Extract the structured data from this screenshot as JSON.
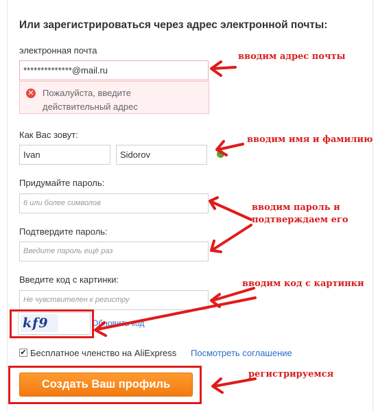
{
  "form": {
    "heading": "Или зарегистрироваться через адрес электронной почты:",
    "email": {
      "label": "электронная почта",
      "value": "**************@mail.ru",
      "error": "Пожалуйста, введите действительный адрес"
    },
    "name": {
      "label": "Как Вас зовут:",
      "first_name": "Ivan",
      "last_name": "Sidorov"
    },
    "password": {
      "label": "Придумайте пароль:",
      "placeholder": "6 или более символов"
    },
    "confirm_password": {
      "label": "Подтвердите пароль:",
      "placeholder": "Введите пароль ещё раз"
    },
    "captcha": {
      "label": "Введите код с картинки:",
      "placeholder": "Не чувствителен к регистру",
      "image_text": "kf9",
      "refresh_link": "Обновить код"
    },
    "membership": {
      "checked": true,
      "check_mark": "✔",
      "text": "Бесплатное членство на AliExpress",
      "agreement_link": "Посмотреть соглашение"
    },
    "submit_label": "Создать Ваш профиль"
  },
  "annotations": {
    "email": "вводим адрес почты",
    "name": "вводим имя и фамилию",
    "password_line1": "вводим пароль и",
    "password_line2": "подтверждаем его",
    "captcha": "вводим код с картинки",
    "submit": "регистрируемся"
  },
  "colors": {
    "button": "#f27b13",
    "annotation": "#d81f1f",
    "link": "#2a6cc8",
    "error_icon": "#e74b3c",
    "ok_icon": "#5aa32b"
  }
}
